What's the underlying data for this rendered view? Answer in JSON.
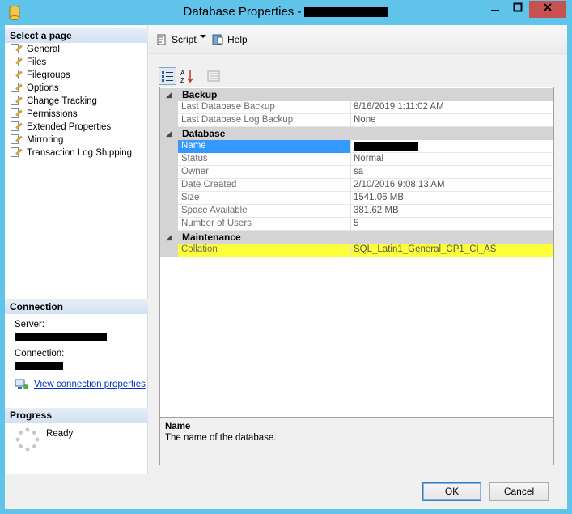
{
  "window": {
    "title": "Database Properties -"
  },
  "left": {
    "select_page_header": "Select a page",
    "pages": [
      {
        "label": "General",
        "selected": true
      },
      {
        "label": "Files"
      },
      {
        "label": "Filegroups"
      },
      {
        "label": "Options"
      },
      {
        "label": "Change Tracking"
      },
      {
        "label": "Permissions"
      },
      {
        "label": "Extended Properties"
      },
      {
        "label": "Mirroring"
      },
      {
        "label": "Transaction Log Shipping"
      }
    ],
    "connection_header": "Connection",
    "server_label": "Server:",
    "connection_label": "Connection:",
    "view_connection_link": "View connection properties",
    "progress_header": "Progress",
    "progress_status": "Ready"
  },
  "toolbar": {
    "script_label": "Script",
    "help_label": "Help"
  },
  "propgrid": {
    "categories": [
      {
        "name": "Backup",
        "rows": [
          {
            "name": "Last Database Backup",
            "value": "8/16/2019 1:11:02 AM"
          },
          {
            "name": "Last Database Log Backup",
            "value": "None"
          }
        ]
      },
      {
        "name": "Database",
        "rows": [
          {
            "name": "Name",
            "value": "",
            "selected": true
          },
          {
            "name": "Status",
            "value": "Normal"
          },
          {
            "name": "Owner",
            "value": "sa"
          },
          {
            "name": "Date Created",
            "value": "2/10/2016 9:08:13 AM"
          },
          {
            "name": "Size",
            "value": "1541.06 MB"
          },
          {
            "name": "Space Available",
            "value": "381.62 MB"
          },
          {
            "name": "Number of Users",
            "value": "5"
          }
        ]
      },
      {
        "name": "Maintenance",
        "rows": [
          {
            "name": "Collation",
            "value": "SQL_Latin1_General_CP1_CI_AS",
            "highlight": true
          }
        ]
      }
    ]
  },
  "description": {
    "title": "Name",
    "text": "The name of the database."
  },
  "buttons": {
    "ok": "OK",
    "cancel": "Cancel"
  },
  "colors": {
    "titlebar": "#5fc3ea",
    "selection": "#3399ff",
    "highlight": "#fdff3a",
    "close": "#c75050"
  }
}
